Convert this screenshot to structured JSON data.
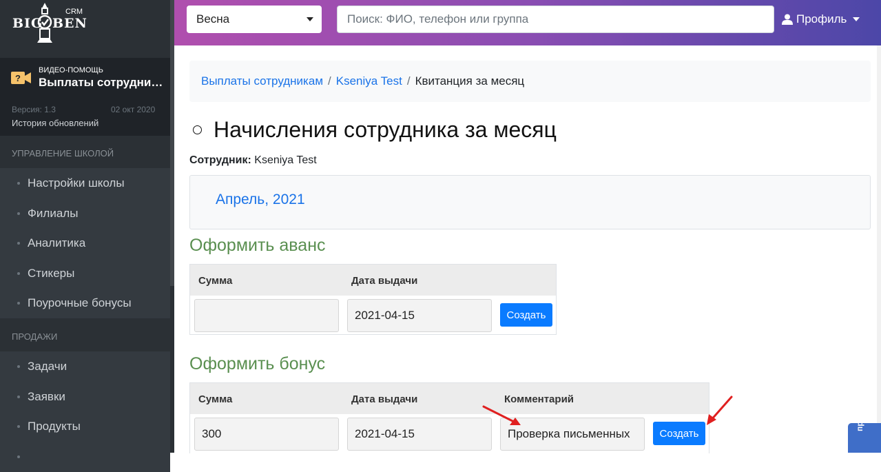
{
  "brand": {
    "big": "BIG",
    "ben": "BEN",
    "crm": "CRM"
  },
  "help": {
    "kicker": "ВИДЕО-ПОМОЩЬ",
    "title": "Выплаты сотрудни…",
    "version": "Версия: 1.3",
    "version_date": "02 окт 2020",
    "history": "История обновлений"
  },
  "sidebar": {
    "sections": [
      {
        "title": "УПРАВЛЕНИЕ ШКОЛОЙ",
        "items": [
          "Настройки школы",
          "Филиалы",
          "Аналитика",
          "Стикеры",
          "Поурочные бонусы"
        ]
      },
      {
        "title": "ПРОДАЖИ",
        "items": [
          "Задачи",
          "Заявки",
          "Продукты"
        ]
      }
    ]
  },
  "topbar": {
    "season": "Весна",
    "search_placeholder": "Поиск: ФИО, телефон или группа",
    "profile": "Профиль"
  },
  "breadcrumb": [
    "Выплаты сотрудникам",
    "Kseniya Test",
    "Квитанция за месяц"
  ],
  "page": {
    "title": "Начисления сотрудника за месяц",
    "employee_label": "Сотрудник:",
    "employee_name": "Kseniya Test",
    "month": "Апрель, 2021"
  },
  "advance": {
    "heading": "Оформить аванс",
    "col_sum": "Сумма",
    "col_date": "Дата выдачи",
    "sum_value": "",
    "date_value": "2021-04-15",
    "button": "Создать"
  },
  "bonus": {
    "heading": "Оформить бонус",
    "col_sum": "Сумма",
    "col_date": "Дата выдачи",
    "col_comment": "Комментарий",
    "sum_value": "300",
    "date_value": "2021-04-15",
    "comment_value": "Проверка письменных",
    "button": "Создать"
  },
  "feedback_tab": "прос",
  "colors": {
    "accent": "#0a7bff",
    "heading_green": "#5a8f50",
    "sidebar_bg": "#2b3035",
    "annotation_arrow": "#e02020"
  }
}
